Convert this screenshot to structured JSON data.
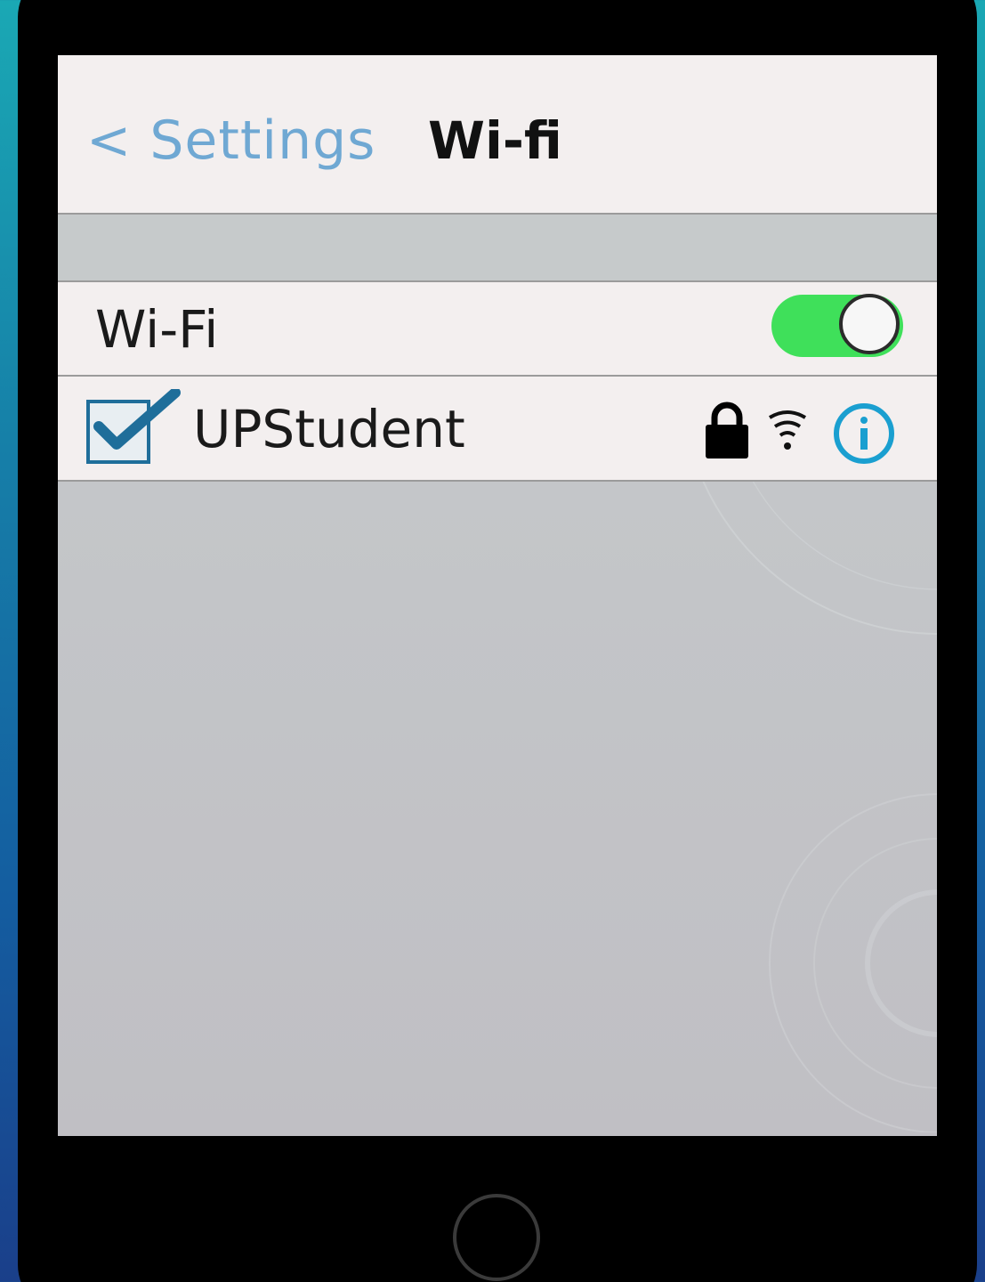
{
  "navbar": {
    "back_label": "< Settings",
    "title": "Wi-fi"
  },
  "wifi_row": {
    "label": "Wi-Fi",
    "toggle_on": true
  },
  "network_row": {
    "name": "UPStudent",
    "checked": true,
    "icons": [
      "checkbox-checked-icon",
      "lock-icon",
      "wifi-signal-icon",
      "info-icon"
    ]
  },
  "colors": {
    "accent": "#6fa8d3",
    "toggle_on": "#3fe05a",
    "info": "#1a9fd0",
    "checkbox": "#1f6e9a"
  }
}
